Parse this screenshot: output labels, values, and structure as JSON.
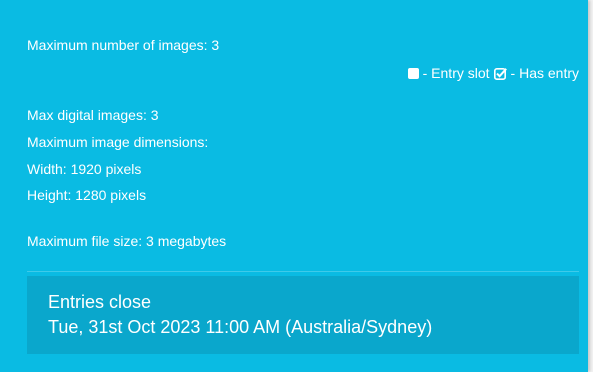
{
  "limits": {
    "max_images": "Maximum number of images: 3",
    "max_digital": "Max digital images: 3",
    "dimensions_heading": "Maximum image dimensions:",
    "width": "Width: 1920 pixels",
    "height": "Height: 1280 pixels",
    "file_size": "Maximum file size: 3 megabytes"
  },
  "legend": {
    "entry_slot": "- Entry slot",
    "has_entry": "- Has entry",
    "slot_icon": "square-icon",
    "entry_icon": "checked-square-icon"
  },
  "closing": {
    "title": "Entries close",
    "date": "Tue, 31st Oct 2023 11:00 AM (Australia/Sydney)"
  },
  "colors": {
    "panel": "#0abbe3",
    "closing_panel": "#0aa7cc",
    "text": "#ffffff"
  }
}
